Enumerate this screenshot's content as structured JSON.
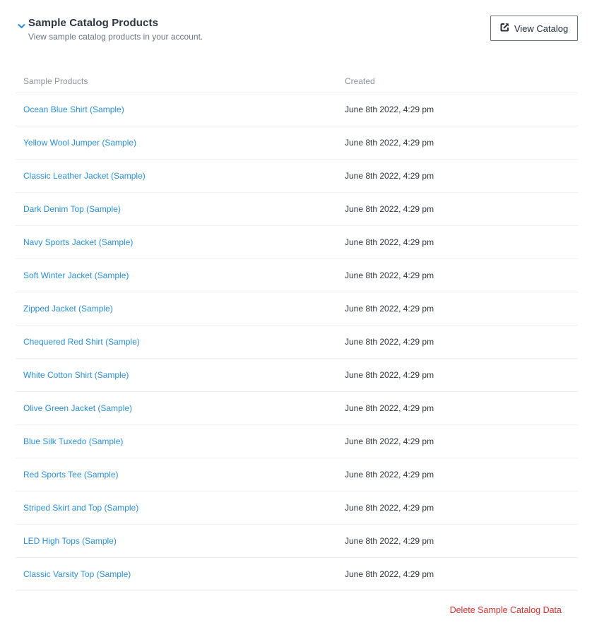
{
  "section": {
    "title": "Sample Catalog Products",
    "subtitle": "View sample catalog products in your account.",
    "collapse_icon": "chevron-down-icon",
    "accent_color": "#2c8fd6"
  },
  "toolbar": {
    "view_catalog_label": "View Catalog",
    "view_catalog_icon": "external-link-icon"
  },
  "table": {
    "columns": [
      "Sample Products",
      "Created"
    ],
    "rows": [
      {
        "name": "Ocean Blue Shirt (Sample)",
        "created": "June 8th 2022, 4:29 pm"
      },
      {
        "name": "Yellow Wool Jumper (Sample)",
        "created": "June 8th 2022, 4:29 pm"
      },
      {
        "name": "Classic Leather Jacket (Sample)",
        "created": "June 8th 2022, 4:29 pm"
      },
      {
        "name": "Dark Denim Top (Sample)",
        "created": "June 8th 2022, 4:29 pm"
      },
      {
        "name": "Navy Sports Jacket (Sample)",
        "created": "June 8th 2022, 4:29 pm"
      },
      {
        "name": "Soft Winter Jacket (Sample)",
        "created": "June 8th 2022, 4:29 pm"
      },
      {
        "name": "Zipped Jacket (Sample)",
        "created": "June 8th 2022, 4:29 pm"
      },
      {
        "name": "Chequered Red Shirt (Sample)",
        "created": "June 8th 2022, 4:29 pm"
      },
      {
        "name": "White Cotton Shirt (Sample)",
        "created": "June 8th 2022, 4:29 pm"
      },
      {
        "name": "Olive Green Jacket (Sample)",
        "created": "June 8th 2022, 4:29 pm"
      },
      {
        "name": "Blue Silk Tuxedo (Sample)",
        "created": "June 8th 2022, 4:29 pm"
      },
      {
        "name": "Red Sports Tee (Sample)",
        "created": "June 8th 2022, 4:29 pm"
      },
      {
        "name": "Striped Skirt and Top (Sample)",
        "created": "June 8th 2022, 4:29 pm"
      },
      {
        "name": "LED High Tops (Sample)",
        "created": "June 8th 2022, 4:29 pm"
      },
      {
        "name": "Classic Varsity Top (Sample)",
        "created": "June 8th 2022, 4:29 pm"
      }
    ]
  },
  "footer": {
    "delete_label": "Delete Sample Catalog Data",
    "delete_color": "#d7312c"
  }
}
